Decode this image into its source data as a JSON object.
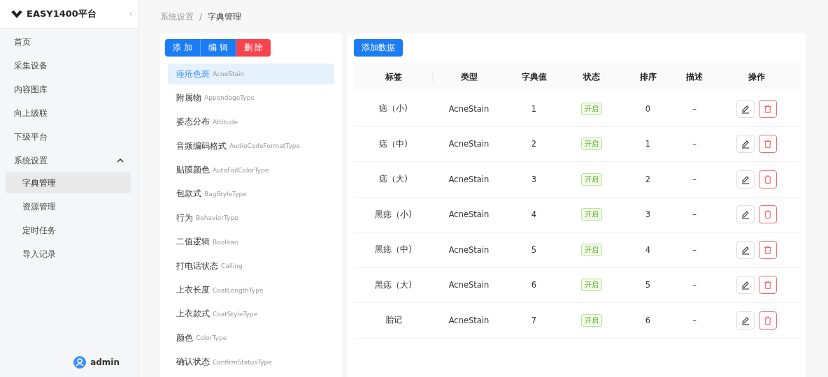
{
  "sidebar": {
    "brand": "EASY1400平台",
    "items": [
      {
        "label": "首页",
        "selected": false
      },
      {
        "label": "采集设备",
        "selected": false
      },
      {
        "label": "内容图库",
        "selected": false
      },
      {
        "label": "向上级联",
        "selected": false
      },
      {
        "label": "下级平台",
        "selected": false
      },
      {
        "label": "系统设置",
        "selected": false,
        "expanded": true,
        "children": [
          {
            "label": "字典管理",
            "selected": true
          },
          {
            "label": "资源管理",
            "selected": false
          },
          {
            "label": "定时任务",
            "selected": false
          },
          {
            "label": "导入记录",
            "selected": false
          }
        ]
      }
    ],
    "user": "admin"
  },
  "breadcrumb": [
    "系统设置",
    "字典管理"
  ],
  "breadcrumb_separator": "/",
  "type_panel": {
    "buttons": [
      {
        "label": "添 加",
        "kind": "primary"
      },
      {
        "label": "编 辑",
        "kind": "primary"
      },
      {
        "label": "删 除",
        "kind": "danger"
      }
    ],
    "items": [
      {
        "name": "痤疮色斑",
        "code": "AcneStain",
        "selected": true
      },
      {
        "name": "附属物",
        "code": "AppendageType",
        "selected": false
      },
      {
        "name": "姿态分布",
        "code": "Attitude",
        "selected": false
      },
      {
        "name": "音频编码格式",
        "code": "AudioCodeFormatType",
        "selected": false
      },
      {
        "name": "贴膜颜色",
        "code": "AutoFoilColorType",
        "selected": false
      },
      {
        "name": "包款式",
        "code": "BagStyleType",
        "selected": false
      },
      {
        "name": "行为",
        "code": "BehaviorType",
        "selected": false
      },
      {
        "name": "二值逻辑",
        "code": "Boolean",
        "selected": false
      },
      {
        "name": "打电话状态",
        "code": "Calling",
        "selected": false
      },
      {
        "name": "上衣长度",
        "code": "CoatLengthType",
        "selected": false
      },
      {
        "name": "上衣款式",
        "code": "CoatStyleType",
        "selected": false
      },
      {
        "name": "颜色",
        "code": "ColorType",
        "selected": false
      },
      {
        "name": "确认状态",
        "code": "ConfirmStatusType",
        "selected": false
      }
    ]
  },
  "data_panel": {
    "add_button": "添加数据",
    "table": {
      "columns": [
        "标签",
        "类型",
        "字典值",
        "状态",
        "排序",
        "描述",
        "操作"
      ],
      "rows": [
        {
          "label": "痣（小)",
          "type": "AcneStain",
          "value": "1",
          "status": "开启",
          "sort": "0",
          "description": "–"
        },
        {
          "label": "痣（中)",
          "type": "AcneStain",
          "value": "2",
          "status": "开启",
          "sort": "1",
          "description": "–"
        },
        {
          "label": "痣（大)",
          "type": "AcneStain",
          "value": "3",
          "status": "开启",
          "sort": "2",
          "description": "–"
        },
        {
          "label": "黑痣（小)",
          "type": "AcneStain",
          "value": "4",
          "status": "开启",
          "sort": "3",
          "description": "–"
        },
        {
          "label": "黑痣（中)",
          "type": "AcneStain",
          "value": "5",
          "status": "开启",
          "sort": "4",
          "description": "–"
        },
        {
          "label": "黑痣（大)",
          "type": "AcneStain",
          "value": "6",
          "status": "开启",
          "sort": "5",
          "description": "–"
        },
        {
          "label": "胎记",
          "type": "AcneStain",
          "value": "7",
          "status": "开启",
          "sort": "6",
          "description": "–"
        }
      ]
    }
  }
}
